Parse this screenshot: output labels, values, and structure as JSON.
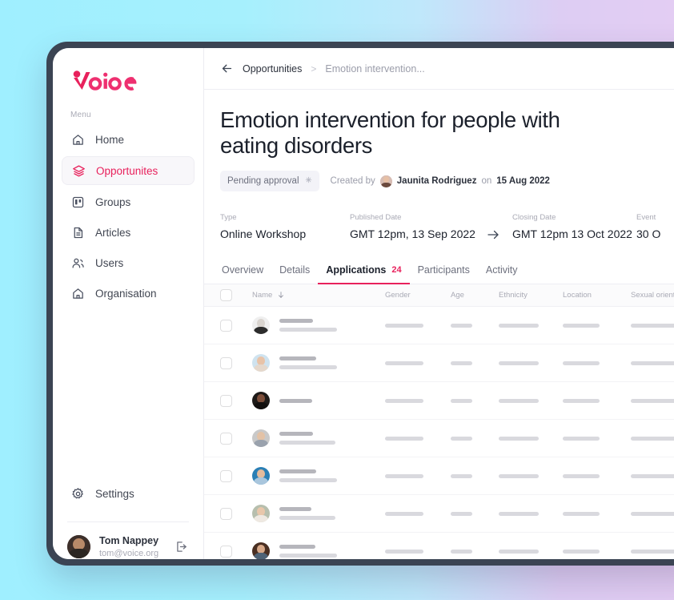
{
  "brand": {
    "name": "Voice",
    "color": "#e8215c"
  },
  "sidebar": {
    "menu_label": "Menu",
    "items": [
      {
        "label": "Home",
        "icon": "home-icon"
      },
      {
        "label": "Opportunites",
        "icon": "layers-icon"
      },
      {
        "label": "Groups",
        "icon": "board-icon"
      },
      {
        "label": "Articles",
        "icon": "document-icon"
      },
      {
        "label": "Users",
        "icon": "users-icon"
      },
      {
        "label": "Organisation",
        "icon": "building-icon"
      }
    ],
    "active_index": 1,
    "settings": {
      "label": "Settings",
      "icon": "gear-icon"
    },
    "user": {
      "name": "Tom Nappey",
      "email": "tom@voice.org",
      "logout_icon": "logout-icon"
    }
  },
  "topbar": {
    "back_icon": "arrow-left-icon",
    "breadcrumb_parent": "Opportunities",
    "breadcrumb_sep": ">",
    "breadcrumb_current": "Emotion intervention..."
  },
  "page": {
    "title": "Emotion intervention for people with eating disorders",
    "status": {
      "label": "Pending approval",
      "icon": "sparkle-icon"
    },
    "created_prefix": "Created by",
    "created_author": "Jaunita Rodriguez",
    "created_joiner": "on",
    "created_date": "15 Aug 2022"
  },
  "facts": [
    {
      "label": "Type",
      "value": "Online Workshop"
    },
    {
      "label": "Published Date",
      "value": "GMT 12pm, 13 Sep 2022"
    },
    {
      "label": "Closing Date",
      "value": "GMT 12pm 13 Oct 2022"
    },
    {
      "label": "Event",
      "value": "30 O"
    }
  ],
  "fact_arrow_icon": "arrow-right-icon",
  "tabs": [
    {
      "label": "Overview",
      "badge": ""
    },
    {
      "label": "Details",
      "badge": ""
    },
    {
      "label": "Applications",
      "badge": "24"
    },
    {
      "label": "Participants",
      "badge": ""
    },
    {
      "label": "Activity",
      "badge": ""
    }
  ],
  "active_tab_index": 2,
  "table": {
    "columns": [
      "Name",
      "Gender",
      "Age",
      "Ethnicity",
      "Location",
      "Sexual orientation"
    ],
    "sort_column": "Name",
    "sort_icon": "arrow-down-icon",
    "rows": [
      {
        "avatar_bg": "#efefef",
        "skin": "#d9d4cf",
        "cloth": "#2c2c2c"
      },
      {
        "avatar_bg": "#cfe3ef",
        "skin": "#e8c3a8",
        "cloth": "#e5d8cc"
      },
      {
        "avatar_bg": "#1d1a18",
        "skin": "#7c4e3a",
        "cloth": "#120f0e"
      },
      {
        "avatar_bg": "#c9c9c9",
        "skin": "#e3c2a6",
        "cloth": "#9aa2ad"
      },
      {
        "avatar_bg": "#2a7fb5",
        "skin": "#e3bb9c",
        "cloth": "#a9c6dd"
      },
      {
        "avatar_bg": "#b7bfae",
        "skin": "#e8c7ab",
        "cloth": "#efe9e2"
      },
      {
        "avatar_bg": "#4a2f22",
        "skin": "#d8a989",
        "cloth": "#4f6377"
      }
    ]
  }
}
